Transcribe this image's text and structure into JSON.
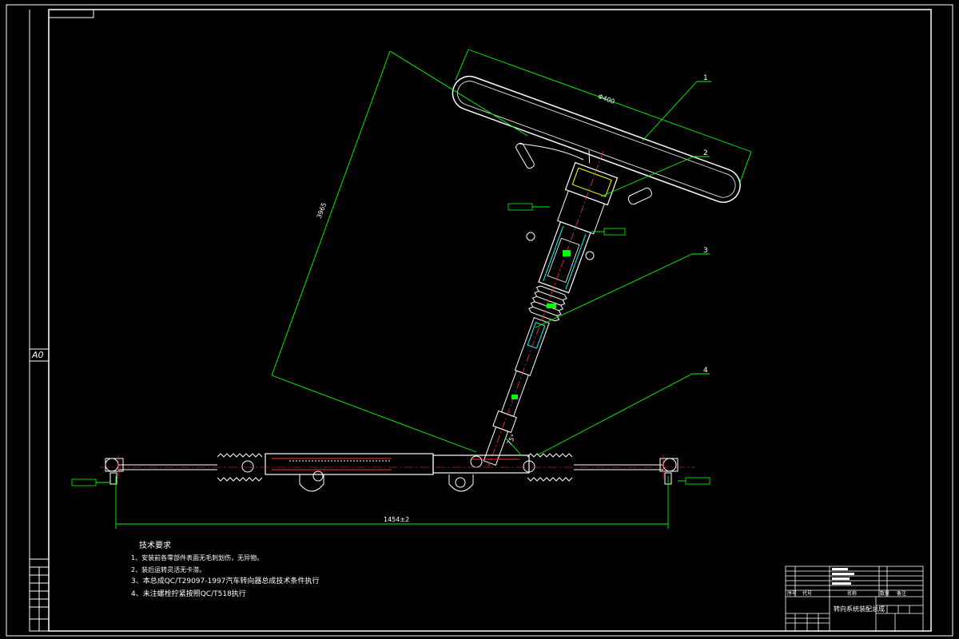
{
  "drawing": {
    "sheet_size": "A0",
    "title": "转向系统装配总成",
    "dimensions": {
      "wheel_diameter": "Φ400",
      "column_length": "3965",
      "track_width": "1454±2",
      "angle": "75°"
    },
    "balloons": [
      "1",
      "2",
      "3",
      "4"
    ],
    "tech_requirements": {
      "heading": "技术要求",
      "items": [
        "1、安装前各零部件表面无毛刺划伤，无异物。",
        "2、装后运转灵活无卡滞。",
        "3、本总成QC/T29097-1997汽车转向器总成技术条件执行",
        "4、未注螺栓拧紧按照QC/T518执行"
      ]
    },
    "title_block": {
      "col_seq": "序号",
      "col_code": "代号",
      "col_name": "名称",
      "col_qty": "数量",
      "col_remark": "备注"
    }
  },
  "colors": {
    "background": "#000000",
    "frame": "#ffffff",
    "dimension": "#00ff00",
    "part_outline": "#ffffff",
    "center_line": "#ff3030",
    "section": "#00ffff",
    "highlight": "#ffff00"
  }
}
